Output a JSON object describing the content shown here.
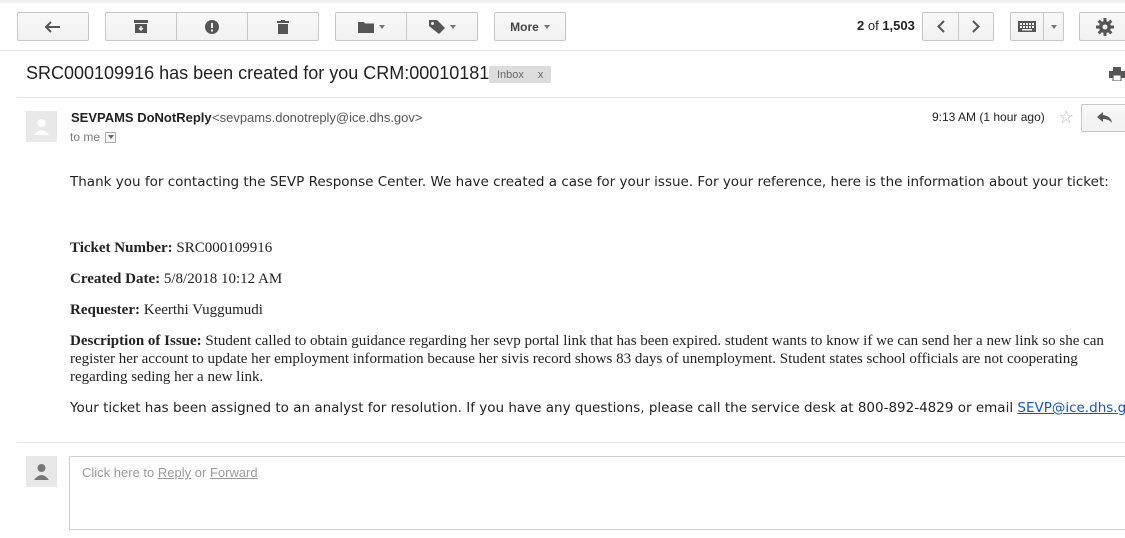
{
  "toolbar": {
    "more_label": "More",
    "counter_current": "2",
    "counter_of": "of",
    "counter_total": "1,503"
  },
  "email": {
    "subject": "SRC000109916 has been created for you CRM:00010181",
    "label": "Inbox",
    "label_remove": "x",
    "sender_name": "SEVPAMS DoNotReply",
    "sender_email": "<sevpams.donotreply@ice.dhs.gov>",
    "to": "to me",
    "time": "9:13 AM (1 hour ago)",
    "intro": "Thank you for contacting the SEVP Response Center. We have created a case for your issue. For your reference, here is the information about your ticket:",
    "ticket_number_label": "Ticket Number:",
    "ticket_number": "SRC000109916",
    "created_date_label": "Created Date:",
    "created_date": "5/8/2018 10:12 AM",
    "requester_label": "Requester:",
    "requester": "Keerthi Vuggumudi",
    "description_label": "Description of Issue:",
    "description": "Student called to obtain guidance regarding her sevp portal link that has been expired. student wants to know if we can send her a new link so she can register her account to update her employment information because her sivis record shows 83 days of unemployment. Student states school officials are not cooperating regarding seding her a new link.",
    "closing_text": "Your ticket has been assigned to an analyst for resolution. If you have any questions, please call the service desk at 800-892-4829 or email",
    "closing_email": "SEVP@ice.dhs.gov",
    "closing_end": "."
  },
  "reply_box": {
    "prefix": "Click here to",
    "reply_link": "Reply",
    "or": "or",
    "forward_link": "Forward"
  },
  "icons": {
    "back": "back-arrow-icon",
    "archive": "archive-icon",
    "spam": "report-spam-icon",
    "delete": "trash-icon",
    "folder": "move-to-folder-icon",
    "label": "label-tag-icon",
    "prev": "chevron-left-icon",
    "next": "chevron-right-icon",
    "keyboard": "keyboard-icon",
    "settings": "gear-icon",
    "print": "print-icon",
    "star": "star-icon",
    "reply": "reply-icon",
    "avatar": "avatar-icon"
  }
}
